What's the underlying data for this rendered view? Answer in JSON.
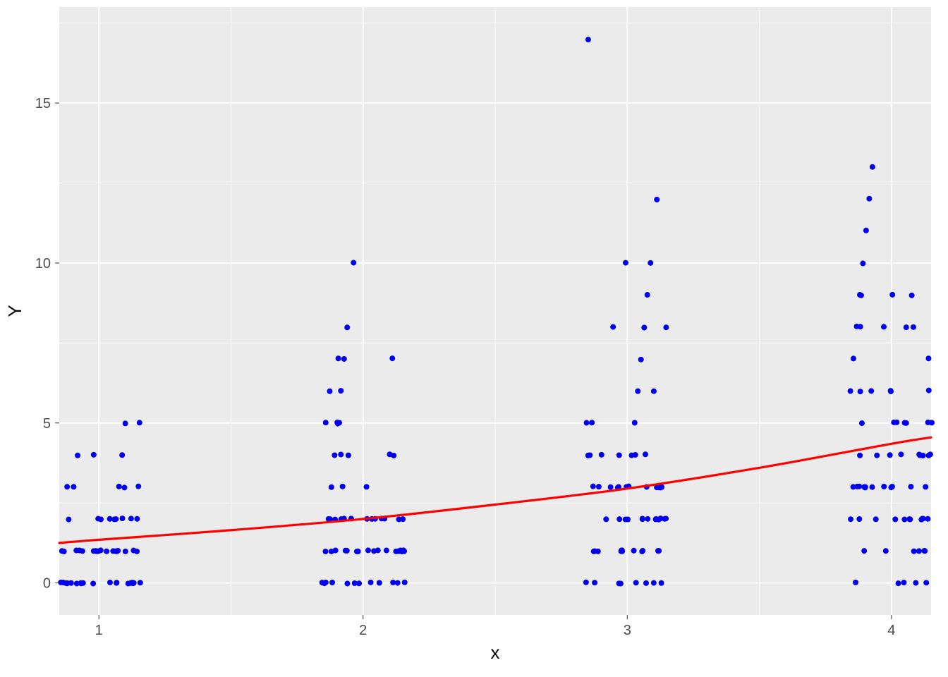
{
  "chart_data": {
    "type": "scatter",
    "xlabel": "x",
    "ylabel": "Y",
    "title": "",
    "xlim": [
      0.85,
      4.15
    ],
    "ylim": [
      -1.0,
      18.0
    ],
    "x_ticks": [
      1,
      2,
      3,
      4
    ],
    "y_ticks": [
      0,
      5,
      10,
      15
    ],
    "point_color": "#0000ee",
    "trend_color": "#ff0000",
    "panel_bg": "#ebebeb",
    "grid_color": "#ffffff",
    "columns": [
      {
        "x": 1,
        "y_values": {
          "0": 21,
          "1": 18,
          "2": 9,
          "3": 5,
          "4": 3,
          "5": 2
        }
      },
      {
        "x": 2,
        "y_values": {
          "0": 12,
          "1": 18,
          "2": 13,
          "3": 3,
          "4": 5,
          "5": 4,
          "6": 2,
          "7": 3,
          "8": 1,
          "10": 1
        }
      },
      {
        "x": 3,
        "y_values": {
          "0": 8,
          "1": 12,
          "2": 13,
          "3": 13,
          "4": 7,
          "5": 3,
          "6": 2,
          "7": 1,
          "8": 3,
          "9": 1,
          "10": 2,
          "12": 1,
          "17": 1
        }
      },
      {
        "x": 4,
        "y_values": {
          "0": 5,
          "1": 6,
          "2": 11,
          "3": 12,
          "4": 9,
          "5": 7,
          "6": 6,
          "7": 2,
          "8": 5,
          "9": 4,
          "10": 1,
          "11": 1,
          "12": 1,
          "13": 1
        }
      }
    ],
    "trend_line": [
      {
        "x": 0.85,
        "y": 1.25
      },
      {
        "x": 1.0,
        "y": 1.35
      },
      {
        "x": 1.5,
        "y": 1.65
      },
      {
        "x": 2.0,
        "y": 2.0
      },
      {
        "x": 2.5,
        "y": 2.45
      },
      {
        "x": 3.0,
        "y": 2.95
      },
      {
        "x": 3.5,
        "y": 3.6
      },
      {
        "x": 4.0,
        "y": 4.35
      },
      {
        "x": 4.15,
        "y": 4.55
      }
    ]
  }
}
